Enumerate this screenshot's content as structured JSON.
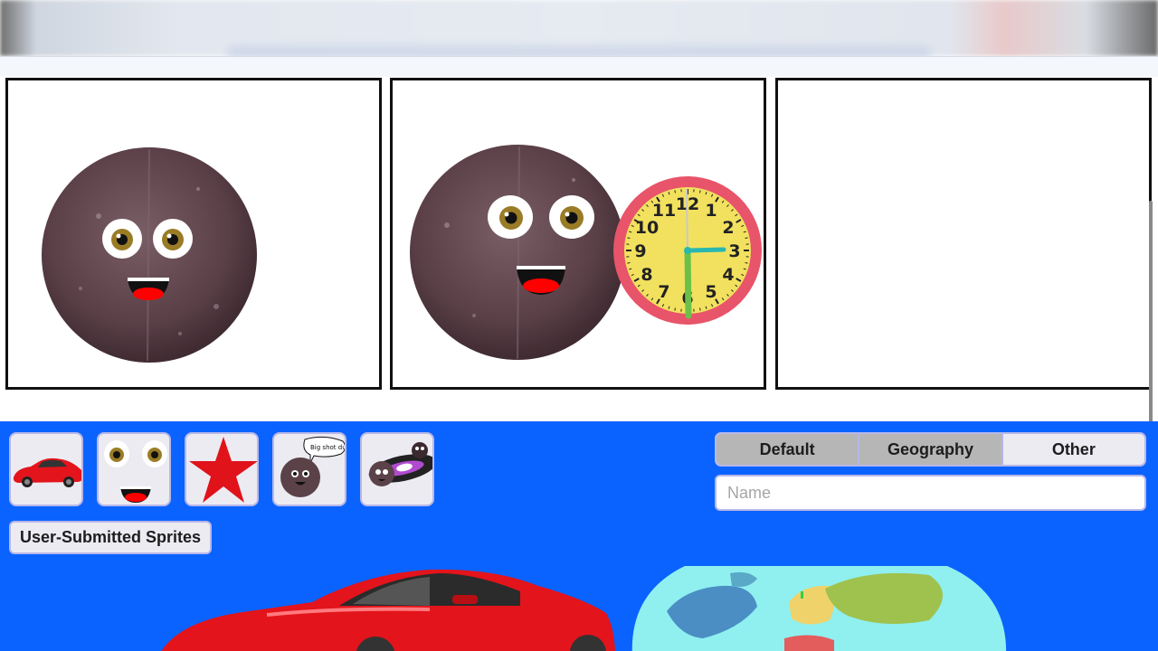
{
  "sprites": [
    {
      "name": "red car",
      "icon": "car-icon"
    },
    {
      "name": "eyes and mouth",
      "icon": "face-icon"
    },
    {
      "name": "red star",
      "icon": "star-icon"
    },
    {
      "name": "planet with speech bubble",
      "icon": "speech-planet-icon",
      "bubble_text": "Big shot dude"
    },
    {
      "name": "planet with galaxy",
      "icon": "galaxy-planet-icon"
    }
  ],
  "user_submitted_label": "User-Submitted Sprites",
  "tabs": [
    {
      "label": "Default",
      "selected": true
    },
    {
      "label": "Geography",
      "selected": true
    },
    {
      "label": "Other",
      "selected": false
    }
  ],
  "name_input": {
    "placeholder": "Name",
    "value": ""
  },
  "clock": {
    "numbers": [
      "12",
      "1",
      "2",
      "3",
      "4",
      "5",
      "6",
      "7",
      "8",
      "9",
      "10",
      "11"
    ],
    "time": "3:30"
  },
  "colors": {
    "editor_bg": "#0a63ff",
    "planet": "#5b4249",
    "mouth": "#ff0000",
    "clock_rim": "#e8546a",
    "clock_face": "#f2e15e",
    "car": "#e3141b",
    "ocean": "#8ff0ef"
  }
}
